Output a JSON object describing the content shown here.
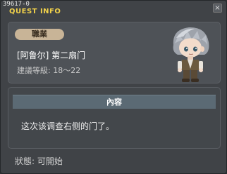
{
  "window": {
    "id": "39617-0",
    "title": "QUEST INFO",
    "close_label": "×"
  },
  "quest": {
    "job_label": "職業",
    "name": "[阿鲁尔] 第二扇门",
    "level_label": "建議等級: 18～22"
  },
  "content": {
    "header": "內容",
    "text": "这次该调查右侧的门了。"
  },
  "status": {
    "label": "狀態: 可開始"
  },
  "colors": {
    "title": "#f2d24a",
    "badge": "#c8b497",
    "header_bar": "#5b6a74"
  }
}
